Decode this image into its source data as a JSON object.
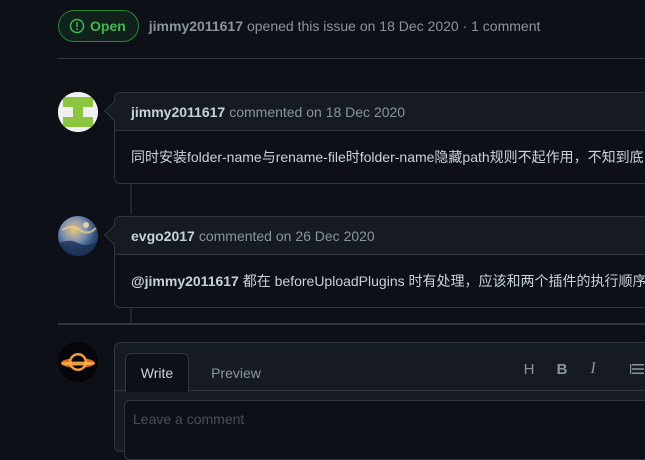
{
  "issue": {
    "status": "Open",
    "author": "jimmy2011617",
    "summary": "opened this issue on 18 Dec 2020 · 1 comment"
  },
  "comments": [
    {
      "user": "jimmy2011617",
      "meta": "commented on 18 Dec 2020",
      "body": "同时安装folder-name与rename-file时folder-name隐藏path规则不起作用，不知到底"
    },
    {
      "user": "evgo2017",
      "meta": "commented on 26 Dec 2020",
      "mention": "@jimmy2011617",
      "body": " 都在 beforeUploadPlugins 时有处理，应该和两个插件的执行顺序有"
    }
  ],
  "editor": {
    "tabs": [
      "Write",
      "Preview"
    ],
    "toolbar": {
      "heading": "H",
      "bold": "B",
      "italic": "I"
    },
    "placeholder": "Leave a comment"
  }
}
